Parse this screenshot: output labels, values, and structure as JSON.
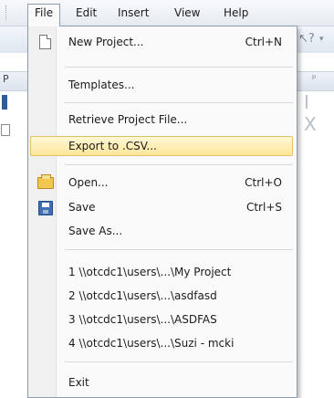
{
  "menubar": {
    "items": [
      {
        "label": "File"
      },
      {
        "label": "Edit"
      },
      {
        "label": "Insert"
      },
      {
        "label": "View"
      },
      {
        "label": "Help"
      }
    ]
  },
  "background": {
    "panel_letter": "P",
    "gray_glyphs": "I X"
  },
  "file_menu": {
    "items": [
      {
        "label": "New Project...",
        "shortcut": "Ctrl+N",
        "icon": "new-document-icon"
      },
      {
        "label": "Templates..."
      },
      {
        "label": "Retrieve Project File..."
      },
      {
        "label": "Export to .CSV...",
        "highlighted": true
      },
      {
        "label": "Open...",
        "shortcut": "Ctrl+O",
        "icon": "open-folder-icon"
      },
      {
        "label": "Save",
        "shortcut": "Ctrl+S",
        "icon": "save-disk-icon"
      },
      {
        "label": "Save As..."
      },
      {
        "label": "1 \\\\otcdc1\\users\\...\\My Project"
      },
      {
        "label": "2 \\\\otcdc1\\users\\...\\asdfasd"
      },
      {
        "label": "3 \\\\otcdc1\\users\\...\\ASDFAS"
      },
      {
        "label": "4 \\\\otcdc1\\users\\...\\Suzi - mcki"
      },
      {
        "label": "Exit"
      }
    ]
  },
  "colors": {
    "highlight_fill": "#fde69a",
    "highlight_border": "#e5c365",
    "menu_border": "#8f9bad"
  }
}
